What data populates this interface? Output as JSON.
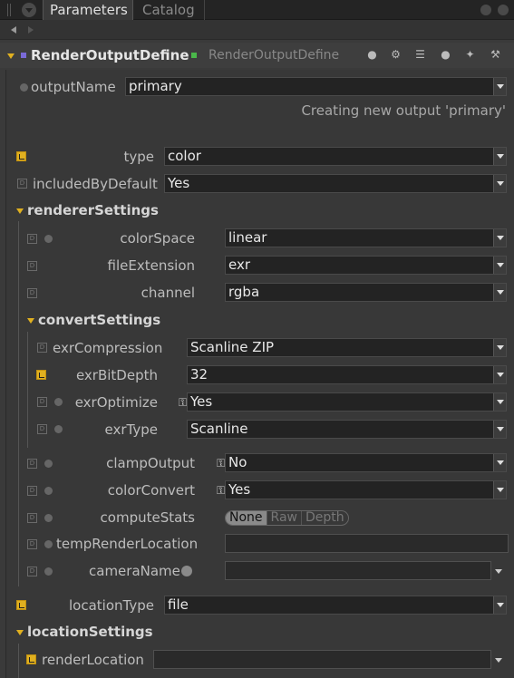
{
  "tabs": {
    "active": "Parameters",
    "other": "Catalog"
  },
  "node": {
    "name": "RenderOutputDefine",
    "type": "RenderOutputDefine"
  },
  "status": {
    "message": "Creating new output 'primary'"
  },
  "params": {
    "outputName": {
      "label": "outputName",
      "value": "primary"
    },
    "type": {
      "label": "type",
      "value": "color"
    },
    "includedByDefault": {
      "label": "includedByDefault",
      "value": "Yes"
    },
    "locationType": {
      "label": "locationType",
      "value": "file"
    }
  },
  "rendererSettings": {
    "title": "rendererSettings",
    "colorSpace": {
      "label": "colorSpace",
      "value": "linear"
    },
    "fileExtension": {
      "label": "fileExtension",
      "value": "exr"
    },
    "channel": {
      "label": "channel",
      "value": "rgba"
    },
    "clampOutput": {
      "label": "clampOutput",
      "value": "No"
    },
    "colorConvert": {
      "label": "colorConvert",
      "value": "Yes"
    },
    "computeStats": {
      "label": "computeStats",
      "options": [
        "None",
        "Raw",
        "Depth"
      ],
      "selected": "None"
    },
    "tempRenderLocation": {
      "label": "tempRenderLocation",
      "value": ""
    },
    "cameraName": {
      "label": "cameraName",
      "value": ""
    }
  },
  "convertSettings": {
    "title": "convertSettings",
    "exrCompression": {
      "label": "exrCompression",
      "value": "Scanline ZIP"
    },
    "exrBitDepth": {
      "label": "exrBitDepth",
      "value": "32"
    },
    "exrOptimize": {
      "label": "exrOptimize",
      "value": "Yes"
    },
    "exrType": {
      "label": "exrType",
      "value": "Scanline"
    }
  },
  "locationSettings": {
    "title": "locationSettings",
    "renderLocation": {
      "label": "renderLocation",
      "value": ""
    }
  },
  "colors": {
    "accent": "#e0b020",
    "background": "#3a3a3a",
    "field": "#232323"
  }
}
